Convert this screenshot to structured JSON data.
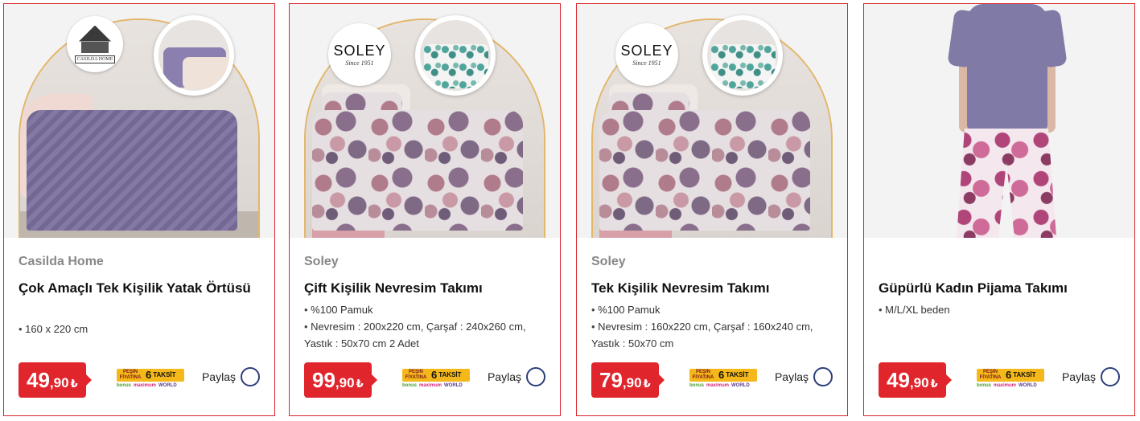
{
  "products": [
    {
      "brand": "Casilda Home",
      "title": "Çok Amaçlı Tek Kişilik Yatak Örtüsü",
      "specs": [
        "160 x 220 cm"
      ],
      "price_main": "49",
      "price_cents": ",90",
      "currency": "₺",
      "logo_text": "CASILDA HOME",
      "share_label": "Paylaş"
    },
    {
      "brand": "Soley",
      "title": "Çift Kişilik Nevresim Takımı",
      "specs": [
        "%100 Pamuk",
        "Nevresim : 200x220 cm, Çarşaf : 240x260 cm, Yastık : 50x70 cm 2 Adet"
      ],
      "price_main": "99",
      "price_cents": ",90",
      "currency": "₺",
      "logo_word": "SOLEY",
      "logo_since": "Since 1951",
      "share_label": "Paylaş"
    },
    {
      "brand": "Soley",
      "title": "Tek Kişilik Nevresim Takımı",
      "specs": [
        "%100 Pamuk",
        "Nevresim : 160x220 cm, Çarşaf : 160x240 cm, Yastık : 50x70 cm"
      ],
      "price_main": "79",
      "price_cents": ",90",
      "currency": "₺",
      "logo_word": "SOLEY",
      "logo_since": "Since 1951",
      "share_label": "Paylaş"
    },
    {
      "brand": "",
      "title": "Güpürlü Kadın Pijama Takımı",
      "specs": [
        "M/L/XL beden"
      ],
      "price_main": "49",
      "price_cents": ",90",
      "currency": "₺",
      "share_label": "Paylaş"
    }
  ],
  "installment": {
    "pesin_line1": "PEŞİN",
    "pesin_line2": "FİYATINA",
    "number": "6",
    "word": "TAKSİT",
    "cards": [
      "bonus",
      "maximum",
      "WORLD"
    ]
  },
  "colors": {
    "card_border": "#d9262c",
    "price_badge": "#e0252d",
    "share_circle": "#2d3d7a",
    "installment_bg": "#f5b81a"
  }
}
